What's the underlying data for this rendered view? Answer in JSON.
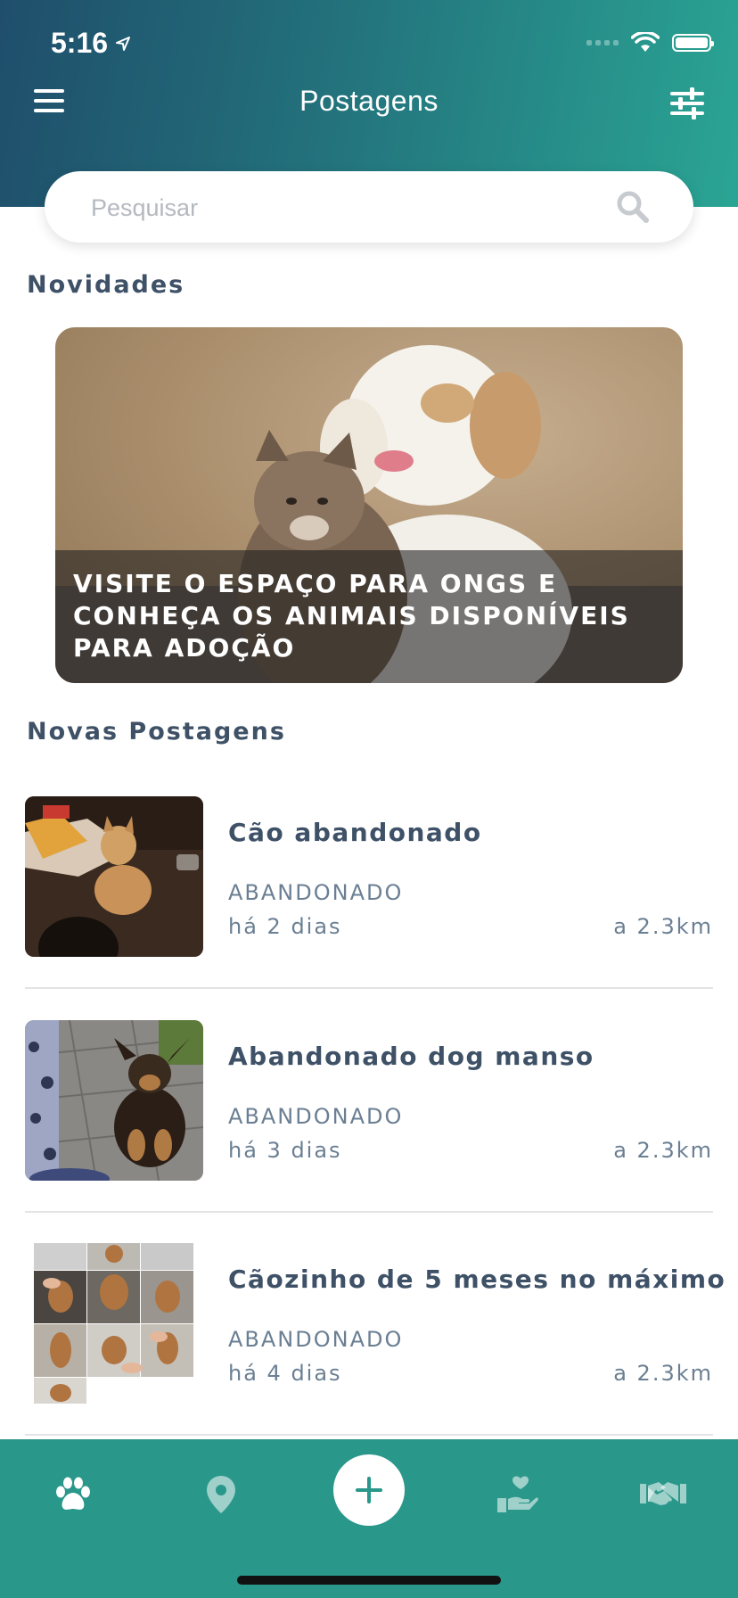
{
  "status_bar": {
    "time": "5:16"
  },
  "header": {
    "title": "Postagens"
  },
  "search": {
    "placeholder": "Pesquisar"
  },
  "sections": {
    "news": "Novidades",
    "new_posts": "Novas Postagens"
  },
  "banner": {
    "text": "VISITE O ESPAÇO PARA ONGS E CONHEÇA OS ANIMAIS DISPONÍVEIS PARA ADOÇÃO"
  },
  "posts": [
    {
      "title": "Cão abandonado",
      "status": "ABANDONADO",
      "time": "há 2 dias",
      "distance": "a 2.3km"
    },
    {
      "title": "Abandonado dog manso",
      "status": "ABANDONADO",
      "time": "há 3 dias",
      "distance": "a 2.3km"
    },
    {
      "title": "Cãozinho de 5 meses no máximo",
      "status": "ABANDONADO",
      "time": "há 4 dias",
      "distance": "a 2.3km"
    }
  ],
  "tabbar": {
    "icons": [
      "paw-icon",
      "map-pin-icon",
      "plus-icon",
      "heart-hand-icon",
      "handshake-icon"
    ]
  },
  "colors": {
    "header_start": "#1f4e6b",
    "header_end": "#2aa594",
    "tabbar": "#2a978b",
    "text_primary": "#3e5167",
    "text_secondary": "#6b7f93"
  }
}
